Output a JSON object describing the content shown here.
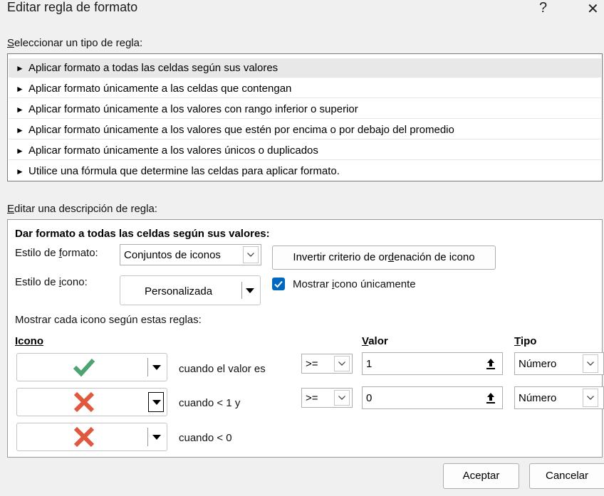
{
  "window": {
    "title": "Editar regla de formato",
    "help_glyph": "?",
    "close_glyph": "✕"
  },
  "rule_type": {
    "label": "Seleccionar un tipo de regla:",
    "items": [
      "Aplicar formato a todas las celdas según sus valores",
      "Aplicar formato únicamente a las celdas que contengan",
      "Aplicar formato únicamente a los valores con rango inferior o superior",
      "Aplicar formato únicamente a los valores que estén por encima o por debajo del promedio",
      "Aplicar formato únicamente a los valores únicos o duplicados",
      "Utilice una fórmula que determine las celdas para aplicar formato."
    ],
    "selected_index": 0,
    "bullet": "►"
  },
  "description": {
    "label": "Editar una descripción de regla:",
    "heading": "Dar formato a todas las celdas según sus valores:",
    "format_style_label": "Estilo de formato:",
    "format_style_value": "Conjuntos de iconos",
    "reverse_button": "Invertir criterio de ordenación de icono",
    "icon_style_label": "Estilo de icono:",
    "icon_style_value": "Personalizada",
    "show_icon_only_label": "Mostrar icono únicamente",
    "show_icon_only_checked": true,
    "rules_label": "Mostrar cada icono según estas reglas:",
    "col_icon": "Icono",
    "col_value": "Valor",
    "col_type": "Tipo",
    "rows": [
      {
        "icon": "green-check-icon",
        "condition": "cuando el valor es",
        "operator": ">=",
        "value": "1",
        "type": "Número"
      },
      {
        "icon": "red-x-icon",
        "condition": "cuando < 1 y",
        "operator": ">=",
        "value": "0",
        "type": "Número"
      },
      {
        "icon": "red-x-icon",
        "condition": "cuando < 0"
      }
    ]
  },
  "footer": {
    "ok": "Aceptar",
    "cancel": "Cancelar"
  },
  "colors": {
    "accent": "#0067c0",
    "check_green": "#4ea372",
    "x_red": "#e0593f"
  }
}
